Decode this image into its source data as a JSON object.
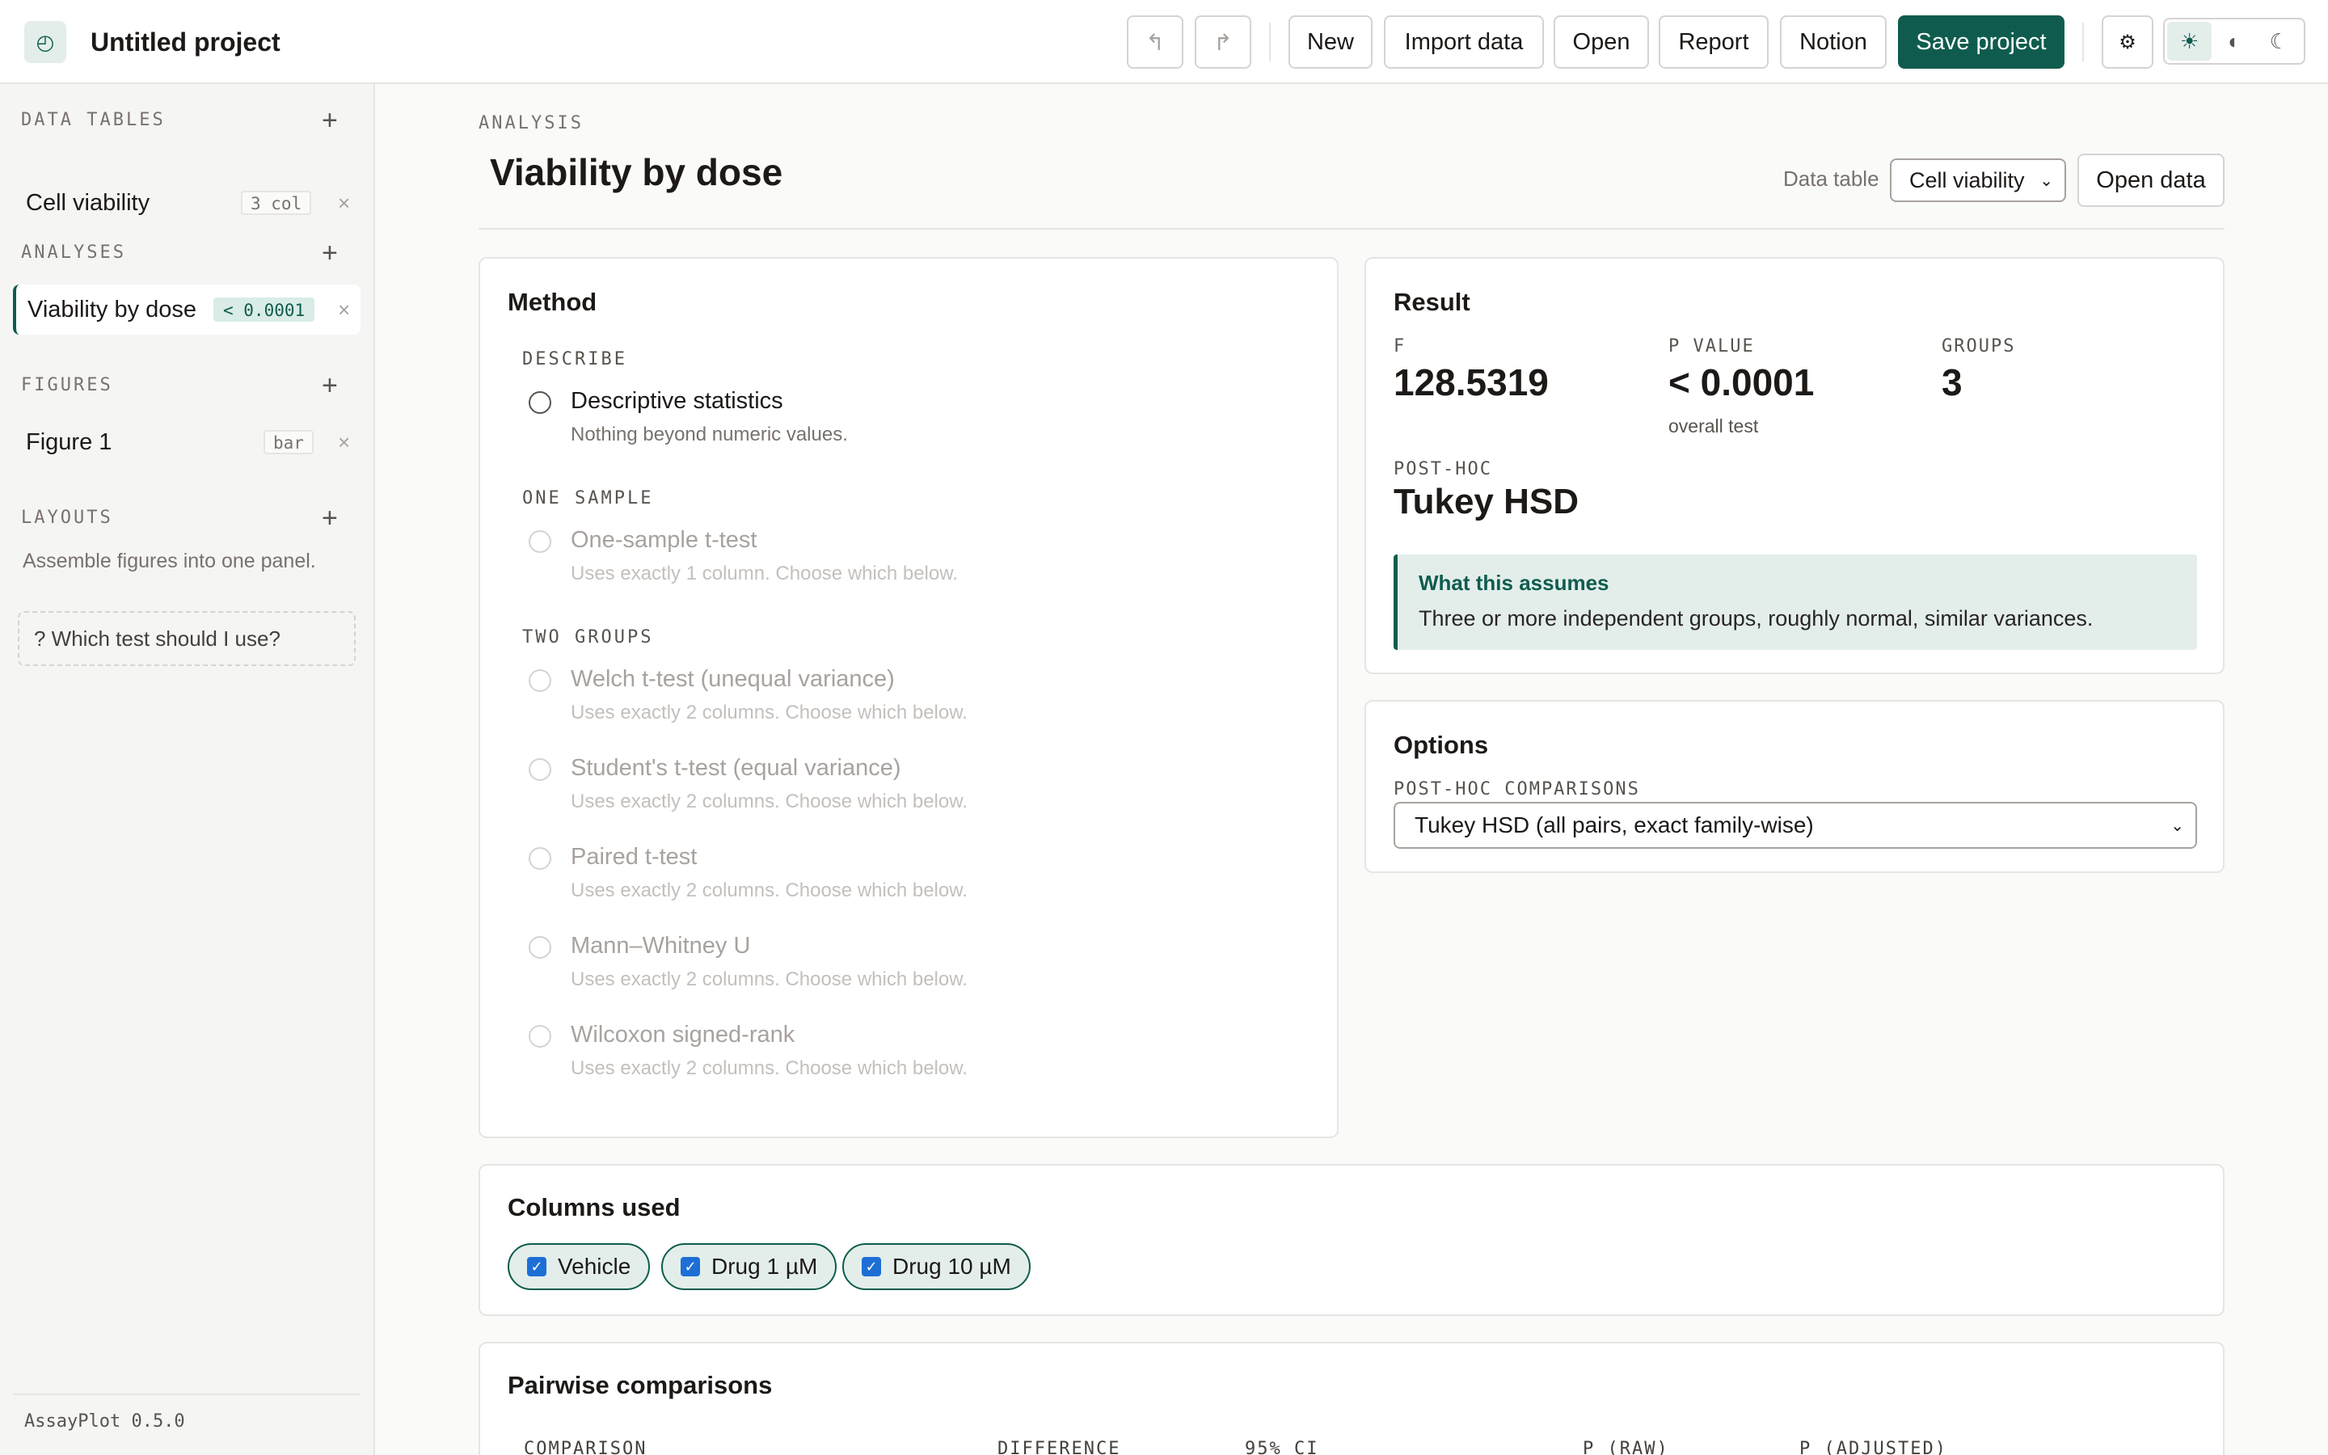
{
  "app": {
    "project_title": "Untitled project",
    "logo_glyph": "◴",
    "version": "AssayPlot 0.5.0"
  },
  "toolbar": {
    "undo_icon": "↰",
    "redo_icon": "↱",
    "new_label": "New",
    "import_label": "Import data",
    "open_label": "Open",
    "report_label": "Report",
    "notion_label": "Notion",
    "save_label": "Save project",
    "settings_icon": "⚙",
    "theme_light": "☀",
    "theme_contrast": "◐",
    "theme_dark": "☾"
  },
  "sidebar": {
    "data_tables": {
      "heading": "DATA TABLES",
      "add": "+",
      "items": [
        {
          "label": "Cell viability",
          "badge": "3 col",
          "remove": "×"
        }
      ]
    },
    "analyses": {
      "heading": "ANALYSES",
      "add": "+",
      "items": [
        {
          "label": "Viability by dose",
          "badge": "< 0.0001",
          "remove": "×"
        }
      ]
    },
    "figures": {
      "heading": "FIGURES",
      "add": "+",
      "items": [
        {
          "label": "Figure 1",
          "badge": "bar",
          "remove": "×"
        }
      ]
    },
    "layouts": {
      "heading": "LAYOUTS",
      "add": "+",
      "description": "Assemble figures into one panel."
    },
    "helper": "?  Which test should I use?"
  },
  "page": {
    "eyebrow": "ANALYSIS",
    "title": "Viability by dose",
    "data_table_label": "Data table",
    "data_table_value": "Cell viability",
    "open_data_label": "Open data"
  },
  "method": {
    "title": "Method",
    "groups": [
      {
        "heading": "DESCRIBE",
        "options": [
          {
            "label": "Descriptive statistics",
            "sub": "Nothing beyond numeric values."
          }
        ]
      },
      {
        "heading": "ONE SAMPLE",
        "options": [
          {
            "label": "One-sample t-test",
            "sub": "Uses exactly 1 column. Choose which below."
          }
        ]
      },
      {
        "heading": "TWO GROUPS",
        "options": [
          {
            "label": "Welch t-test (unequal variance)",
            "sub": "Uses exactly 2 columns. Choose which below."
          },
          {
            "label": "Student's t-test (equal variance)",
            "sub": "Uses exactly 2 columns. Choose which below."
          },
          {
            "label": "Paired t-test",
            "sub": "Uses exactly 2 columns. Choose which below."
          },
          {
            "label": "Mann–Whitney U",
            "sub": "Uses exactly 2 columns. Choose which below."
          },
          {
            "label": "Wilcoxon signed-rank",
            "sub": "Uses exactly 2 columns. Choose which below."
          }
        ]
      }
    ]
  },
  "result": {
    "title": "Result",
    "f_label": "F",
    "f_value": "128.5319",
    "p_label": "P VALUE",
    "p_value": "< 0.0001",
    "p_note": "overall test",
    "groups_label": "GROUPS",
    "groups_value": "3",
    "posthoc_label": "POST-HOC",
    "posthoc_value": "Tukey HSD",
    "assume_title": "What this assumes",
    "assume_text": "Three or more independent groups, roughly normal, similar variances."
  },
  "options": {
    "title": "Options",
    "posthoc_label": "POST-HOC COMPARISONS",
    "posthoc_value": "Tukey HSD (all pairs, exact family-wise)"
  },
  "columns_used": {
    "title": "Columns used",
    "items": [
      {
        "label": "Vehicle",
        "checked": true
      },
      {
        "label": "Drug 1 µM",
        "checked": true
      },
      {
        "label": "Drug 10 µM",
        "checked": true
      }
    ]
  },
  "pairwise": {
    "title": "Pairwise comparisons",
    "headers": [
      "COMPARISON",
      "DIFFERENCE",
      "95% CI",
      "P (RAW)",
      "P (ADJUSTED)"
    ]
  },
  "colors": {
    "accent": "#0f5c4e",
    "accent_tint": "#e3eeeb"
  }
}
